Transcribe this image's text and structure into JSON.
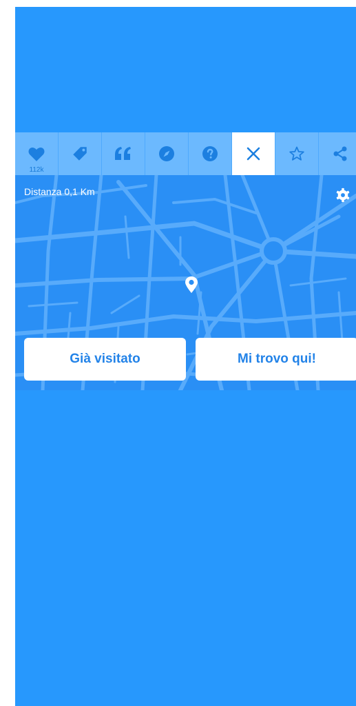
{
  "toolbar": {
    "items": [
      {
        "icon": "heart-icon",
        "count": "112k"
      },
      {
        "icon": "tag-icon"
      },
      {
        "icon": "quote-icon"
      },
      {
        "icon": "compass-icon"
      },
      {
        "icon": "question-icon"
      },
      {
        "icon": "close-icon",
        "active": true
      },
      {
        "icon": "star-icon"
      },
      {
        "icon": "share-icon"
      }
    ]
  },
  "map": {
    "distance": "Distanza 0,1 Km",
    "settings_icon": "gear-icon",
    "pin_icon": "location-pin-icon"
  },
  "actions": {
    "visited_label": "Già visitato",
    "here_label": "Mi trovo qui!"
  },
  "colors": {
    "background": "#2798fd",
    "toolbar": "#6cb9fe",
    "map": "#2a8ff5",
    "icon": "#1c7fe0"
  }
}
